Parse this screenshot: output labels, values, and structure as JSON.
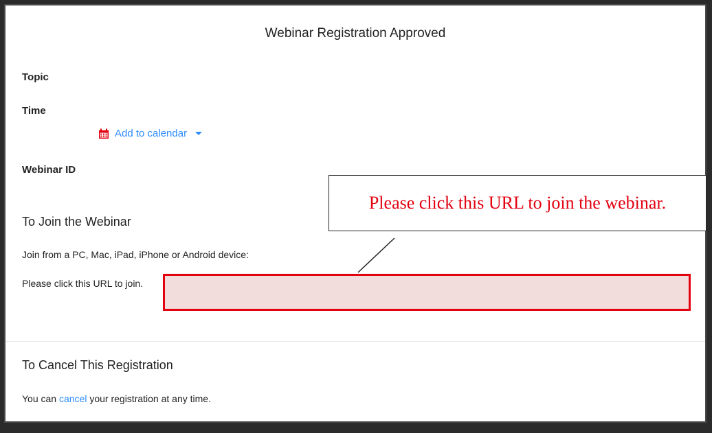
{
  "page": {
    "title": "Webinar Registration Approved"
  },
  "details": {
    "topic_label": "Topic",
    "time_label": "Time",
    "add_to_calendar": "Add to calendar",
    "webinar_id_label": "Webinar ID"
  },
  "join": {
    "heading": "To Join the Webinar",
    "devices_text": "Join from a PC, Mac, iPad, iPhone or Android device:",
    "url_prompt": "Please click this URL to join."
  },
  "callout": {
    "text": "Please click this URL to join the webinar."
  },
  "cancel": {
    "heading": "To Cancel This Registration",
    "prefix": "You can ",
    "link": "cancel",
    "suffix": " your registration at any time."
  },
  "colors": {
    "link": "#2d8cff",
    "highlight_border": "#e3000f",
    "highlight_fill": "#f2dcdc",
    "calendar_icon": "#e3000f"
  },
  "icons": {
    "calendar": "calendar-icon",
    "caret": "caret-down-icon"
  }
}
